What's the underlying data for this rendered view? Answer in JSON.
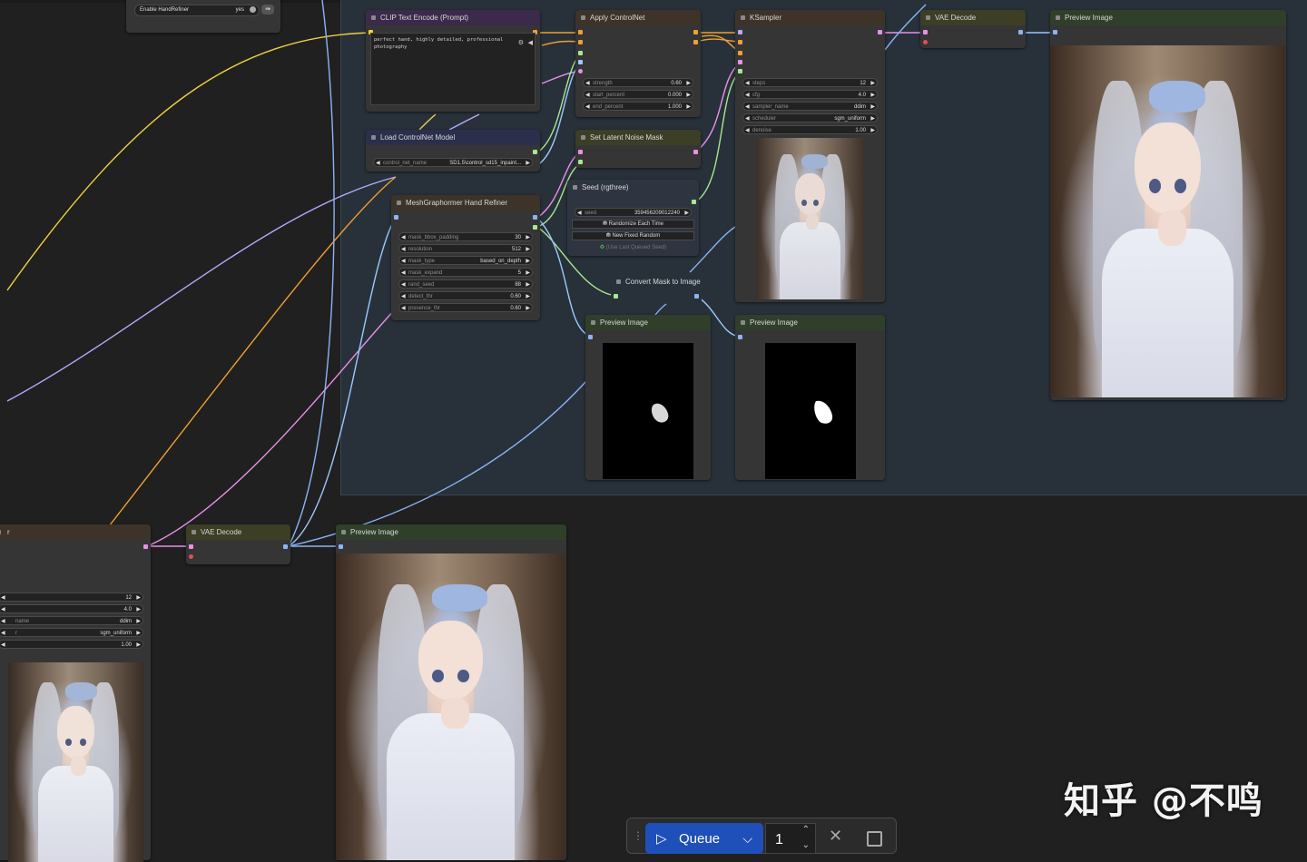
{
  "colors": {
    "wire_yellow": "#f0d040",
    "wire_purple": "#b8a8ff",
    "wire_pink": "#e890e8",
    "wire_blue": "#8ab4f8",
    "wire_orange": "#f0a030",
    "wire_green": "#a8e890",
    "wire_lightblue": "#9cc8ff",
    "queue_blue": "#1f4fb8"
  },
  "top_left_widget": {
    "label": "Enable HandRefiner",
    "value": "yes"
  },
  "nodes": {
    "clip_text_encode": {
      "title": "CLIP Text Encode (Prompt)",
      "prompt": "perfect hand, highly detailed, professional photography"
    },
    "apply_controlnet": {
      "title": "Apply ControlNet",
      "widgets": [
        {
          "label": "strength",
          "value": "0.60"
        },
        {
          "label": "start_percent",
          "value": "0.000"
        },
        {
          "label": "end_percent",
          "value": "1.000"
        }
      ]
    },
    "ksampler": {
      "title": "KSampler",
      "widgets": [
        {
          "label": "steps",
          "value": "12"
        },
        {
          "label": "cfg",
          "value": "4.0"
        },
        {
          "label": "sampler_name",
          "value": "ddim"
        },
        {
          "label": "scheduler",
          "value": "sgm_uniform"
        },
        {
          "label": "denoise",
          "value": "1.00"
        }
      ]
    },
    "vae_decode_top": {
      "title": "VAE Decode"
    },
    "preview_image_top": {
      "title": "Preview Image"
    },
    "load_controlnet": {
      "title": "Load ControlNet Model",
      "widgets": [
        {
          "label": "control_net_name",
          "value": "SD1.5\\control_sd15_inpaint..."
        }
      ]
    },
    "set_latent_noise_mask": {
      "title": "Set Latent Noise Mask"
    },
    "seed": {
      "title": "Seed (rgthree)",
      "widgets": [
        {
          "label": "seed",
          "value": "359456209012240"
        }
      ],
      "buttons": [
        "Randomize Each Time",
        "New Fixed Random"
      ],
      "hint": "(Use Last Queued Seed)"
    },
    "mesh_graphormer": {
      "title": "MeshGraphormer Hand Refiner",
      "widgets": [
        {
          "label": "mask_bbox_padding",
          "value": "30"
        },
        {
          "label": "resolution",
          "value": "512"
        },
        {
          "label": "mask_type",
          "value": "based_on_depth"
        },
        {
          "label": "mask_expand",
          "value": "5"
        },
        {
          "label": "rand_seed",
          "value": "88"
        },
        {
          "label": "detect_thr",
          "value": "0.60"
        },
        {
          "label": "presence_thr",
          "value": "0.60"
        }
      ]
    },
    "convert_mask": {
      "title": "Convert Mask to Image"
    },
    "preview_image_mid1": {
      "title": "Preview Image"
    },
    "preview_image_mid2": {
      "title": "Preview Image"
    },
    "bottom_sampler": {
      "title": "r",
      "widgets": [
        {
          "label": "",
          "value": "12"
        },
        {
          "label": "",
          "value": "4.0"
        },
        {
          "label": "name",
          "value": "ddim"
        },
        {
          "label": "r",
          "value": "sgm_uniform"
        },
        {
          "label": "",
          "value": "1.00"
        }
      ]
    },
    "vae_decode_bottom": {
      "title": "VAE Decode"
    },
    "preview_image_bottom": {
      "title": "Preview Image"
    }
  },
  "queue": {
    "label": "Queue",
    "count": "1"
  },
  "watermark": "知乎 @不鸣"
}
